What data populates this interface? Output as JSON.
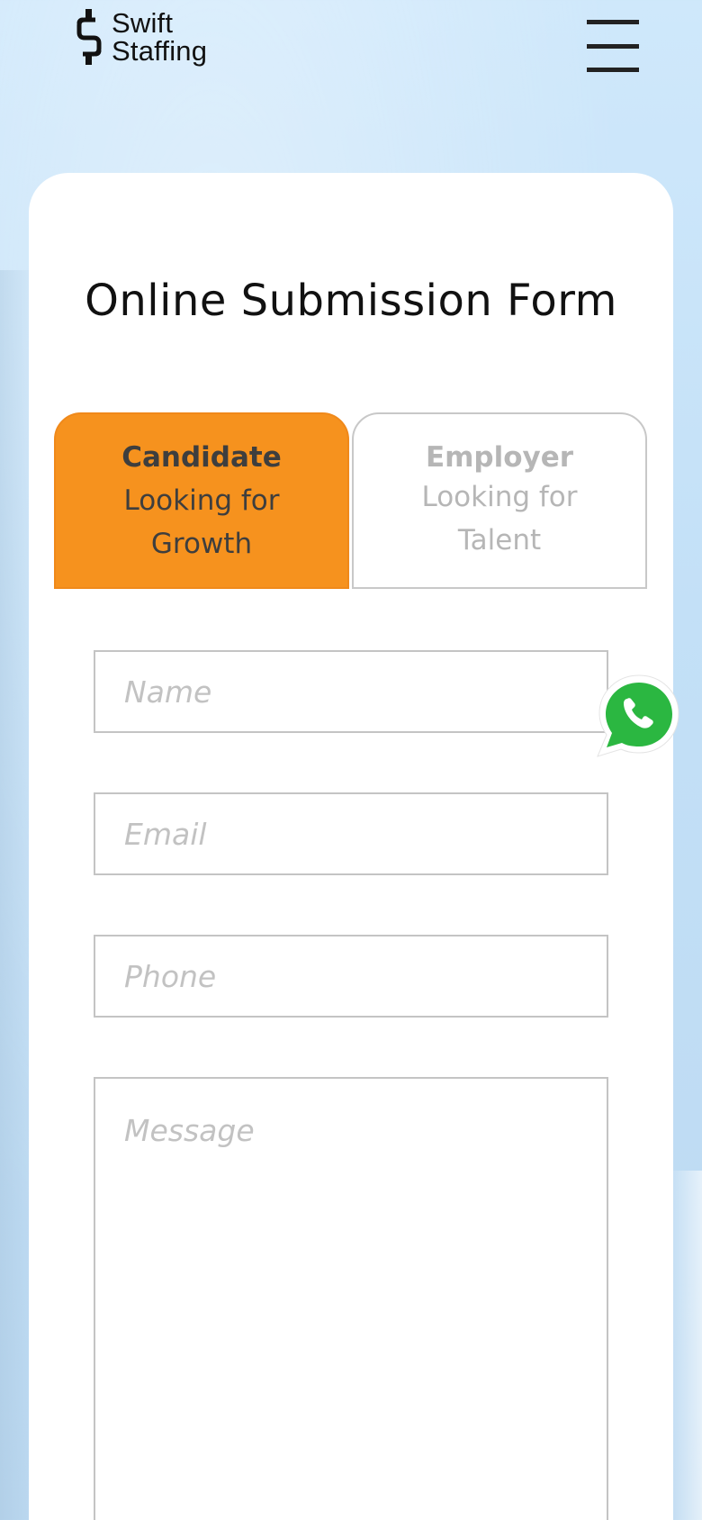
{
  "header": {
    "logo_line1": "Swift",
    "logo_line2": "Staffing",
    "menu_icon": "hamburger-menu-icon"
  },
  "form": {
    "title": "Online Submission Form",
    "tabs": [
      {
        "title": "Candidate",
        "subtitle": "Looking for Growth",
        "active": true
      },
      {
        "title": "Employer",
        "subtitle": "Looking for Talent",
        "active": false
      }
    ],
    "fields": {
      "name_placeholder": "Name",
      "email_placeholder": "Email",
      "phone_placeholder": "Phone",
      "message_placeholder": "Message"
    }
  },
  "floating": {
    "whatsapp_icon": "whatsapp-icon"
  },
  "colors": {
    "accent": "#f6921e",
    "background": "#cfe8fb",
    "whatsapp_green": "#2bb741"
  }
}
